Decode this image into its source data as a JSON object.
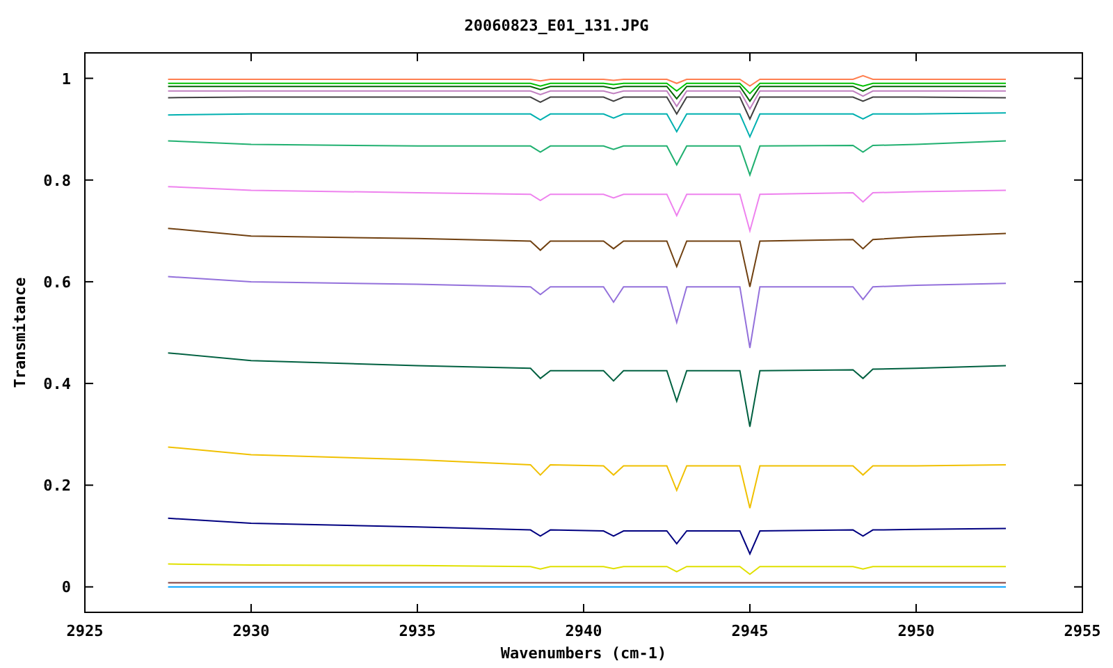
{
  "chart_data": {
    "type": "line",
    "title": "20060823_E01_131.JPG",
    "xlabel": "Wavenumbers (cm-1)",
    "ylabel": "Transmitance",
    "x": [
      2927.5,
      2930,
      2935,
      2938.4,
      2938.7,
      2939,
      2940.6,
      2940.9,
      2941.2,
      2942.5,
      2942.8,
      2943.1,
      2944.7,
      2945,
      2945.3,
      2948.1,
      2948.4,
      2948.7,
      2950,
      2952.7
    ],
    "xlim": [
      2925,
      2955
    ],
    "ylim": [
      -0.05,
      1.05
    ],
    "xticks": [
      2925,
      2930,
      2935,
      2940,
      2945,
      2950,
      2955
    ],
    "yticks": [
      0,
      0.2,
      0.4,
      0.6,
      0.8,
      1
    ],
    "series": [
      {
        "color": "#ff7f50",
        "values": [
          0.998,
          0.998,
          0.998,
          0.998,
          0.995,
          0.998,
          0.998,
          0.996,
          0.998,
          0.998,
          0.99,
          0.998,
          0.998,
          0.985,
          0.998,
          0.998,
          1.005,
          0.998,
          0.998,
          0.998
        ]
      },
      {
        "color": "#00c000",
        "values": [
          0.99,
          0.99,
          0.99,
          0.99,
          0.985,
          0.99,
          0.99,
          0.988,
          0.99,
          0.99,
          0.975,
          0.99,
          0.99,
          0.97,
          0.99,
          0.99,
          0.985,
          0.99,
          0.99,
          0.99
        ]
      },
      {
        "color": "#006400",
        "values": [
          0.984,
          0.984,
          0.984,
          0.984,
          0.978,
          0.984,
          0.984,
          0.98,
          0.984,
          0.984,
          0.96,
          0.984,
          0.984,
          0.955,
          0.984,
          0.984,
          0.975,
          0.984,
          0.984,
          0.984
        ]
      },
      {
        "color": "#c080c0",
        "values": [
          0.975,
          0.975,
          0.975,
          0.975,
          0.968,
          0.975,
          0.975,
          0.97,
          0.975,
          0.975,
          0.945,
          0.975,
          0.975,
          0.94,
          0.975,
          0.975,
          0.965,
          0.975,
          0.975,
          0.975
        ]
      },
      {
        "color": "#404040",
        "values": [
          0.962,
          0.963,
          0.963,
          0.963,
          0.953,
          0.963,
          0.963,
          0.955,
          0.963,
          0.963,
          0.93,
          0.963,
          0.963,
          0.92,
          0.963,
          0.963,
          0.955,
          0.963,
          0.963,
          0.962
        ]
      },
      {
        "color": "#00b0b0",
        "values": [
          0.928,
          0.93,
          0.93,
          0.93,
          0.918,
          0.93,
          0.93,
          0.922,
          0.93,
          0.93,
          0.895,
          0.93,
          0.93,
          0.885,
          0.93,
          0.93,
          0.92,
          0.93,
          0.93,
          0.932
        ]
      },
      {
        "color": "#20b070",
        "values": [
          0.877,
          0.87,
          0.867,
          0.867,
          0.855,
          0.867,
          0.867,
          0.86,
          0.867,
          0.867,
          0.83,
          0.867,
          0.867,
          0.81,
          0.867,
          0.868,
          0.855,
          0.868,
          0.87,
          0.877
        ]
      },
      {
        "color": "#ee82ee",
        "values": [
          0.787,
          0.78,
          0.775,
          0.772,
          0.76,
          0.772,
          0.772,
          0.765,
          0.772,
          0.772,
          0.73,
          0.772,
          0.772,
          0.7,
          0.772,
          0.775,
          0.757,
          0.775,
          0.777,
          0.78
        ]
      },
      {
        "color": "#704010",
        "values": [
          0.705,
          0.69,
          0.685,
          0.68,
          0.662,
          0.68,
          0.68,
          0.665,
          0.68,
          0.68,
          0.63,
          0.68,
          0.68,
          0.59,
          0.68,
          0.683,
          0.665,
          0.683,
          0.688,
          0.695
        ]
      },
      {
        "color": "#9370db",
        "values": [
          0.61,
          0.6,
          0.595,
          0.59,
          0.575,
          0.59,
          0.59,
          0.56,
          0.59,
          0.59,
          0.52,
          0.59,
          0.59,
          0.47,
          0.59,
          0.59,
          0.565,
          0.59,
          0.593,
          0.597
        ]
      },
      {
        "color": "#006040",
        "values": [
          0.46,
          0.445,
          0.435,
          0.43,
          0.41,
          0.425,
          0.425,
          0.405,
          0.425,
          0.425,
          0.365,
          0.425,
          0.425,
          0.315,
          0.425,
          0.427,
          0.41,
          0.428,
          0.43,
          0.435
        ]
      },
      {
        "color": "#f0c000",
        "values": [
          0.275,
          0.26,
          0.25,
          0.24,
          0.22,
          0.24,
          0.238,
          0.22,
          0.238,
          0.238,
          0.19,
          0.238,
          0.238,
          0.155,
          0.238,
          0.238,
          0.22,
          0.238,
          0.238,
          0.24
        ]
      },
      {
        "color": "#000080",
        "values": [
          0.135,
          0.125,
          0.118,
          0.112,
          0.1,
          0.112,
          0.11,
          0.1,
          0.11,
          0.11,
          0.085,
          0.11,
          0.11,
          0.065,
          0.11,
          0.112,
          0.1,
          0.112,
          0.113,
          0.115
        ]
      },
      {
        "color": "#e0e000",
        "values": [
          0.045,
          0.043,
          0.042,
          0.04,
          0.035,
          0.04,
          0.04,
          0.036,
          0.04,
          0.04,
          0.03,
          0.04,
          0.04,
          0.025,
          0.04,
          0.04,
          0.035,
          0.04,
          0.04,
          0.04
        ]
      },
      {
        "color": "#804040",
        "values": [
          0.008,
          0.008,
          0.008,
          0.008,
          0.008,
          0.008,
          0.008,
          0.008,
          0.008,
          0.008,
          0.008,
          0.008,
          0.008,
          0.008,
          0.008,
          0.008,
          0.008,
          0.008,
          0.008,
          0.008
        ]
      },
      {
        "color": "#00a0ff",
        "values": [
          0,
          0,
          0,
          0,
          0,
          0,
          0,
          0,
          0,
          0,
          0,
          0,
          0,
          0,
          0,
          0,
          0,
          0,
          0,
          0
        ]
      }
    ]
  }
}
